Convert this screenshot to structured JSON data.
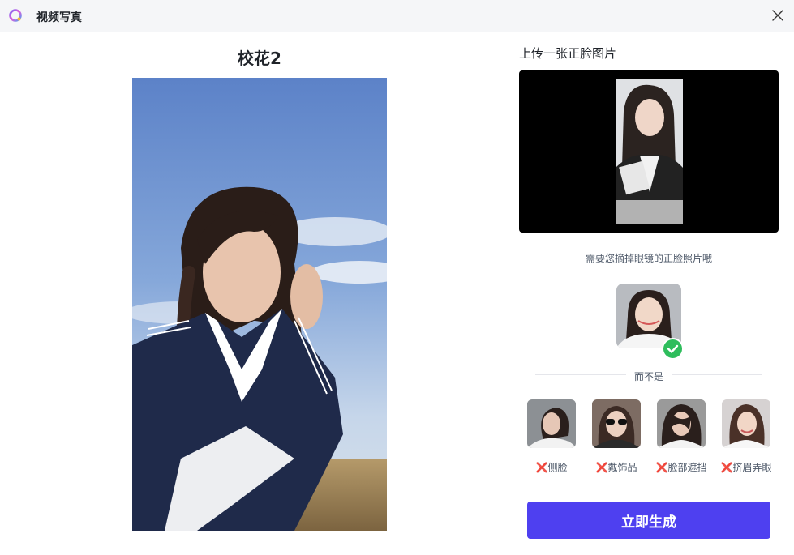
{
  "window": {
    "title": "视频写真"
  },
  "template": {
    "title": "校花2"
  },
  "upload": {
    "title": "上传一张正脸图片",
    "hint": "需要您摘掉眼镜的正脸照片哦"
  },
  "examples": {
    "divider_text": "而不是",
    "bad_items": [
      {
        "label": "侧脸"
      },
      {
        "label": "戴饰品"
      },
      {
        "label": "脸部遮挡"
      },
      {
        "label": "挤眉弄眼"
      }
    ],
    "x_symbol": "❌"
  },
  "actions": {
    "generate_label": "立即生成"
  },
  "colors": {
    "primary": "#4e40f0",
    "success": "#2ebd5c",
    "error": "#f53f3f"
  }
}
